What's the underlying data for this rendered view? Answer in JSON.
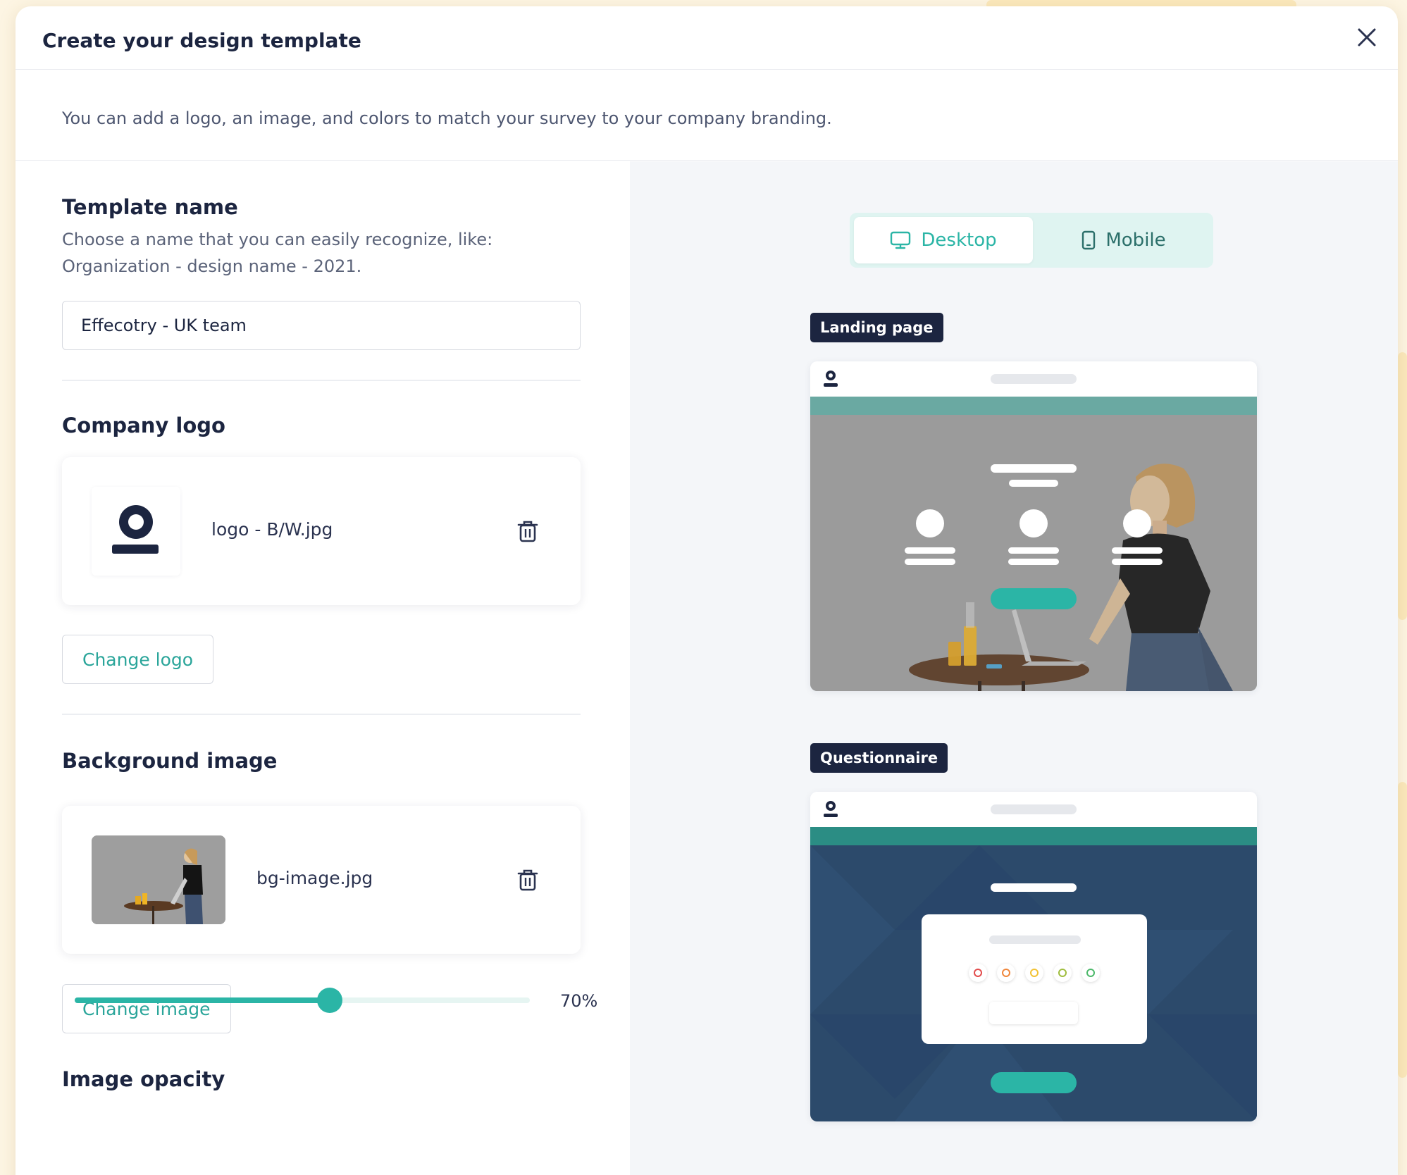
{
  "modal": {
    "title": "Create your design template",
    "intro": "You can add a logo, an image, and colors to match your survey to your company branding."
  },
  "template_name": {
    "heading": "Template name",
    "helper_line1": "Choose a name that you can easily recognize, like:",
    "helper_line2": "Organization - design name - 2021.",
    "value": "Effecotry - UK team"
  },
  "company_logo": {
    "heading": "Company logo",
    "file_name": "logo - B/W.jpg",
    "change_label": "Change logo"
  },
  "background_image": {
    "heading": "Background image",
    "file_name": "bg-image.jpg",
    "change_label": "Change image"
  },
  "image_opacity": {
    "heading": "Image opacity",
    "value_percent": 70,
    "value_label": "70%"
  },
  "preview": {
    "tabs": [
      {
        "label": "Desktop",
        "icon": "monitor-icon",
        "active": true
      },
      {
        "label": "Mobile",
        "icon": "phone-icon",
        "active": false
      }
    ],
    "landing_label": "Landing page",
    "questionnaire_label": "Questionnaire",
    "rating_colors": [
      "#e24b4b",
      "#f0863a",
      "#f2c233",
      "#9fbd3e",
      "#4cb86a"
    ]
  },
  "colors": {
    "accent": "#2bb5a6",
    "navy": "#1c2540",
    "header_bar": "#6aa9a2",
    "questionnaire_bg": "#2c4a6b"
  }
}
